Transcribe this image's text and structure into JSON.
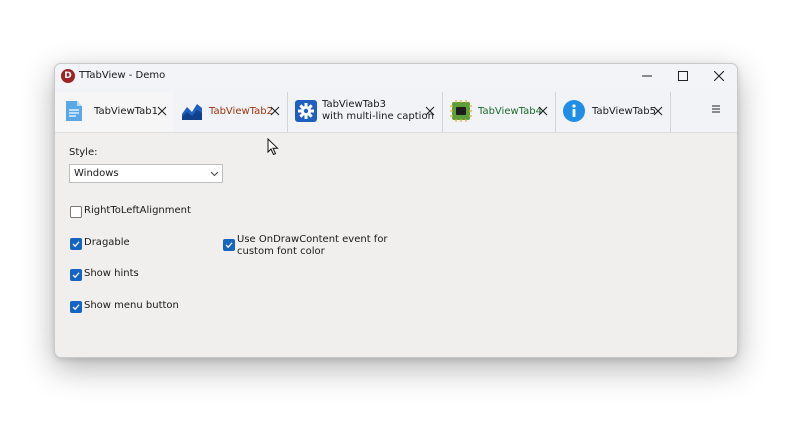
{
  "window": {
    "title": "TTabView - Demo",
    "app_icon_letter": "D"
  },
  "tabs": [
    {
      "label": "TabViewTab1",
      "icon": "document-icon",
      "active": true,
      "color": "#1a1a1a"
    },
    {
      "label": "TabViewTab2",
      "icon": "area-chart-icon",
      "active": false,
      "color": "#a0330f"
    },
    {
      "label_line1": "TabViewTab3",
      "label_line2": "with multi-line caption",
      "icon": "gear-icon",
      "active": false,
      "color": "#1a1a1a"
    },
    {
      "label": "TabViewTab4",
      "icon": "chip-icon",
      "active": false,
      "color": "#1e6b2e"
    },
    {
      "label": "TabViewTab5",
      "icon": "info-icon",
      "active": false,
      "color": "#1a1a1a"
    }
  ],
  "style": {
    "label": "Style:",
    "selected": "Windows"
  },
  "options": {
    "rtl": {
      "label": "RightToLeftAlignment",
      "checked": false
    },
    "dragable": {
      "label": "Dragable",
      "checked": true
    },
    "show_hints": {
      "label": "Show hints",
      "checked": true
    },
    "show_menu_button": {
      "label": "Show menu button",
      "checked": true
    },
    "ondrawcontent": {
      "label_line1": "Use OnDrawContent event for",
      "label_line2": "custom font color",
      "checked": true
    }
  },
  "colors": {
    "accent": "#1565c0",
    "tab2_text": "#a0330f",
    "tab4_text": "#1e6b2e"
  }
}
